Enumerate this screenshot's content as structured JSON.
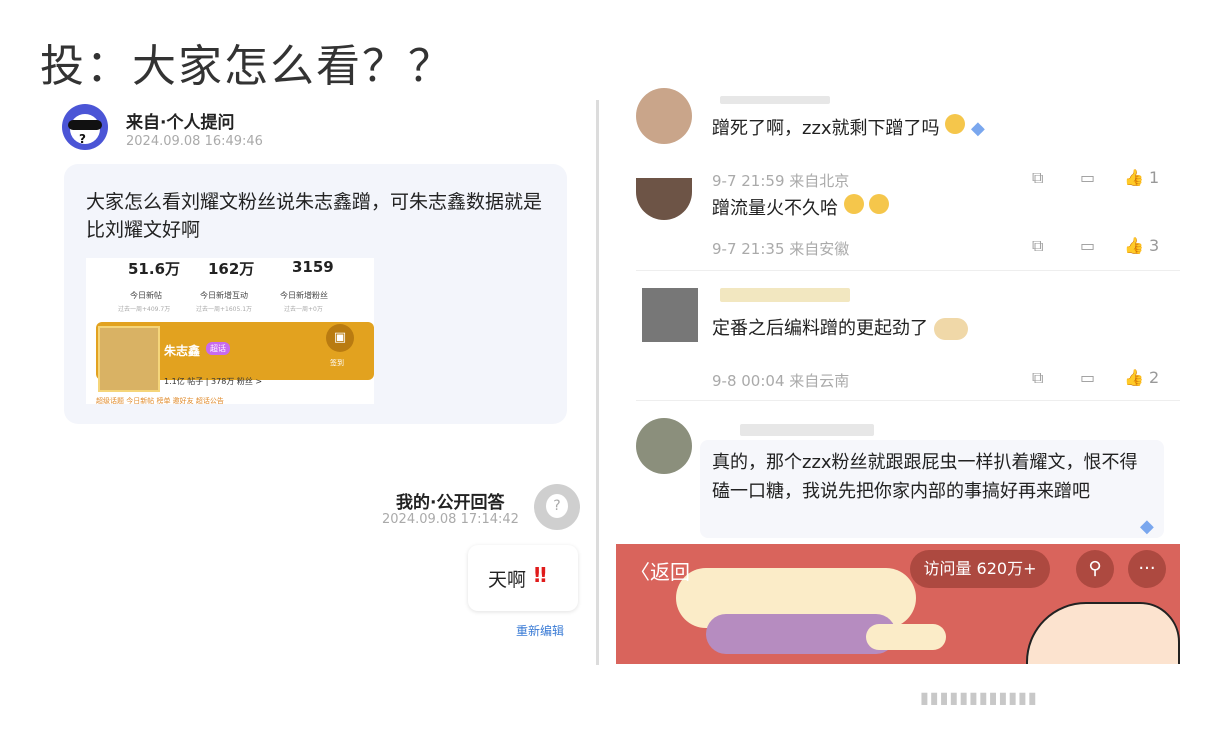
{
  "header": {
    "title": "投：大家怎么看？？"
  },
  "question": {
    "from_label": "来自·个人提问",
    "timestamp": "2024.09.08 16:49:46",
    "text": "大家怎么看刘耀文粉丝说朱志鑫蹭，可朱志鑫数据就是比刘耀文好啊",
    "screenshot": {
      "stats": [
        {
          "value": "51.6万",
          "label": "今日新帖",
          "sub": "过去一周+409.7万"
        },
        {
          "value": "162万",
          "label": "今日新增互动",
          "sub": "过去一周+1605.1万"
        },
        {
          "value": "3159",
          "label": "今日新增粉丝",
          "sub": "过去一周+0万"
        }
      ],
      "name": "朱志鑫",
      "tag": "超话",
      "button_label": "签到",
      "sub_line": "1.1亿 帖子 | 378万 粉丝 >",
      "bottom_strip": "超级话题      今日新帖 榜单      邀好友      超话公告"
    }
  },
  "answer": {
    "from_label": "我的·公开回答",
    "timestamp": "2024.09.08 17:14:42",
    "text": "天啊",
    "mark": "‼",
    "reedit_label": "重新编辑"
  },
  "comments": [
    {
      "text": "蹭死了啊，zzx就剩下蹭了吗",
      "meta": "9-7 21:59 来自北京",
      "likes": "1"
    },
    {
      "text": "蹭流量火不久哈",
      "meta": "9-7 21:35 来自安徽",
      "likes": "3"
    },
    {
      "text": "定番之后编料蹭的更起劲了",
      "meta": "9-8 00:04 来自云南",
      "likes": "2"
    },
    {
      "text": "真的，那个zzx粉丝就跟跟屁虫一样扒着耀文，恨不得磕一口糖，我说先把你家内部的事搞好再来蹭吧",
      "meta": "",
      "likes": ""
    }
  ],
  "bottom_bar": {
    "back_label": "返回",
    "visits_label": "访问量 620万+",
    "search_icon": "search-icon",
    "more_icon": "more-icon",
    "background_color": "#d9645c"
  }
}
